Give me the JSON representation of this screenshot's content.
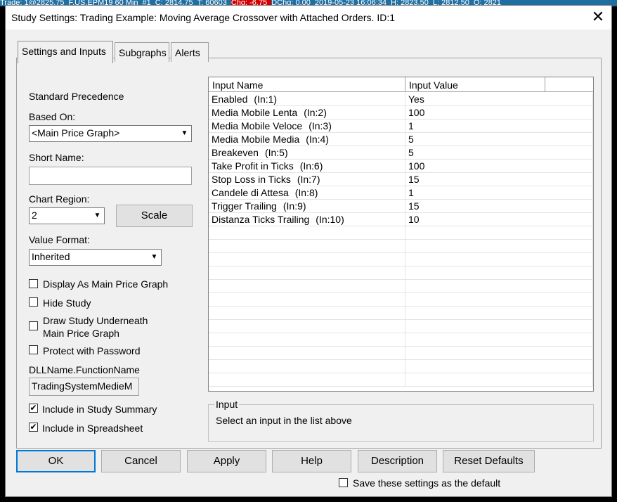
{
  "background": {
    "strip_items": [
      "Trade: 1@2825.75",
      "F.US.EPM19 60 Min",
      "#1",
      "C: 2814.75",
      "T: 60603",
      "Chg: -6.75",
      "DChg: 0.00",
      "2019-05-23 16:06:34",
      "H: 2823.50",
      "L: 2812.50",
      "O: 2821"
    ]
  },
  "dialog": {
    "title": "Study Settings: Trading Example: Moving Average Crossover with Attached Orders. ID:1",
    "close_glyph": "✕"
  },
  "tabs": [
    {
      "label": "Settings and Inputs",
      "active": true
    },
    {
      "label": "Subgraphs",
      "active": false
    },
    {
      "label": "Alerts",
      "active": false
    }
  ],
  "settings": {
    "precedence": "Standard Precedence",
    "based_on_label": "Based On:",
    "based_on_value": "<Main Price Graph>",
    "short_name_label": "Short Name:",
    "short_name_value": "",
    "chart_region_label": "Chart Region:",
    "chart_region_value": "2",
    "scale_button": "Scale",
    "value_format_label": "Value Format:",
    "value_format_value": "Inherited",
    "checkboxes": {
      "display_main": {
        "label": "Display As Main Price Graph",
        "checked": false
      },
      "hide_study": {
        "label": "Hide Study",
        "checked": false
      },
      "draw_underneath_1": "Draw Study Underneath",
      "draw_underneath_2": "Main Price Graph",
      "draw_underneath_checked": false,
      "protect": {
        "label": "Protect with Password",
        "checked": false
      },
      "include_summary": {
        "label": "Include in Study Summary",
        "checked": true
      },
      "include_spreadsheet": {
        "label": "Include in Spreadsheet",
        "checked": true
      }
    },
    "dll_label": "DLLName.FunctionName",
    "dll_value": "TradingSystemMedieM",
    "check_glyph": "✔"
  },
  "inputs_grid": {
    "headers": [
      "Input Name",
      "Input Value"
    ],
    "rows": [
      {
        "name": "Enabled",
        "idx": "(In:1)",
        "value": "Yes"
      },
      {
        "name": "Media Mobile Lenta",
        "idx": "(In:2)",
        "value": "100"
      },
      {
        "name": "Media Mobile Veloce",
        "idx": "(In:3)",
        "value": "1"
      },
      {
        "name": "Media Mobile Media",
        "idx": "(In:4)",
        "value": "5"
      },
      {
        "name": "Breakeven",
        "idx": "(In:5)",
        "value": "5"
      },
      {
        "name": "Take Profit in Ticks",
        "idx": "(In:6)",
        "value": "100"
      },
      {
        "name": "Stop Loss in Ticks",
        "idx": "(In:7)",
        "value": "15"
      },
      {
        "name": "Candele di Attesa",
        "idx": "(In:8)",
        "value": "1"
      },
      {
        "name": "Trigger Trailing",
        "idx": "(In:9)",
        "value": "15"
      },
      {
        "name": "Distanza Ticks Trailing",
        "idx": "(In:10)",
        "value": "10"
      }
    ]
  },
  "input_group": {
    "legend": "Input",
    "text": "Select an input in the list above"
  },
  "footer": {
    "ok": "OK",
    "cancel": "Cancel",
    "apply": "Apply",
    "help": "Help",
    "description": "Description",
    "reset": "Reset Defaults",
    "save_default_label": "Save these settings as the default",
    "save_default_checked": false
  }
}
